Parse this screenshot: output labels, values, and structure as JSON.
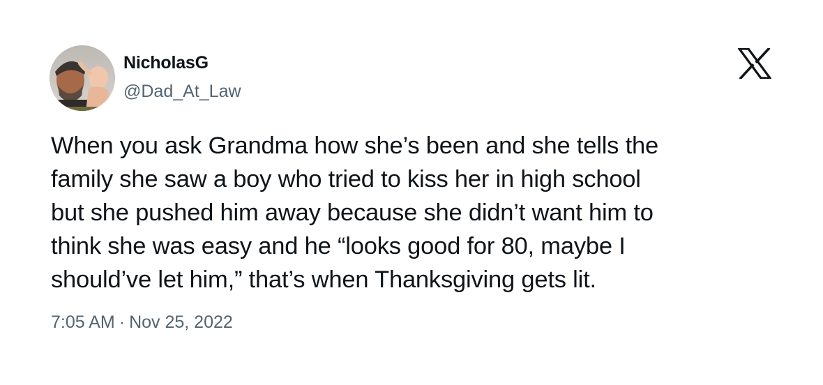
{
  "author": {
    "display_name": "NicholasG",
    "handle": "@Dad_At_Law",
    "avatar_icon": "profile-photo"
  },
  "brand": {
    "logo_icon": "x-logo-icon",
    "color": "#0f1419"
  },
  "tweet": {
    "text": "When you ask Grandma how she’s been and she tells the\nfamily she saw a boy who tried to kiss her in high school\nbut she pushed him away because she didn’t want him to\nthink she was easy and he “looks good for 80, maybe I\nshould’ve let him,” that’s when Thanksgiving gets lit.",
    "time": "7:05 AM",
    "separator": "·",
    "date": "Nov 25, 2022"
  },
  "colors": {
    "text": "#0f1419",
    "secondary": "#536471",
    "background": "#ffffff"
  }
}
